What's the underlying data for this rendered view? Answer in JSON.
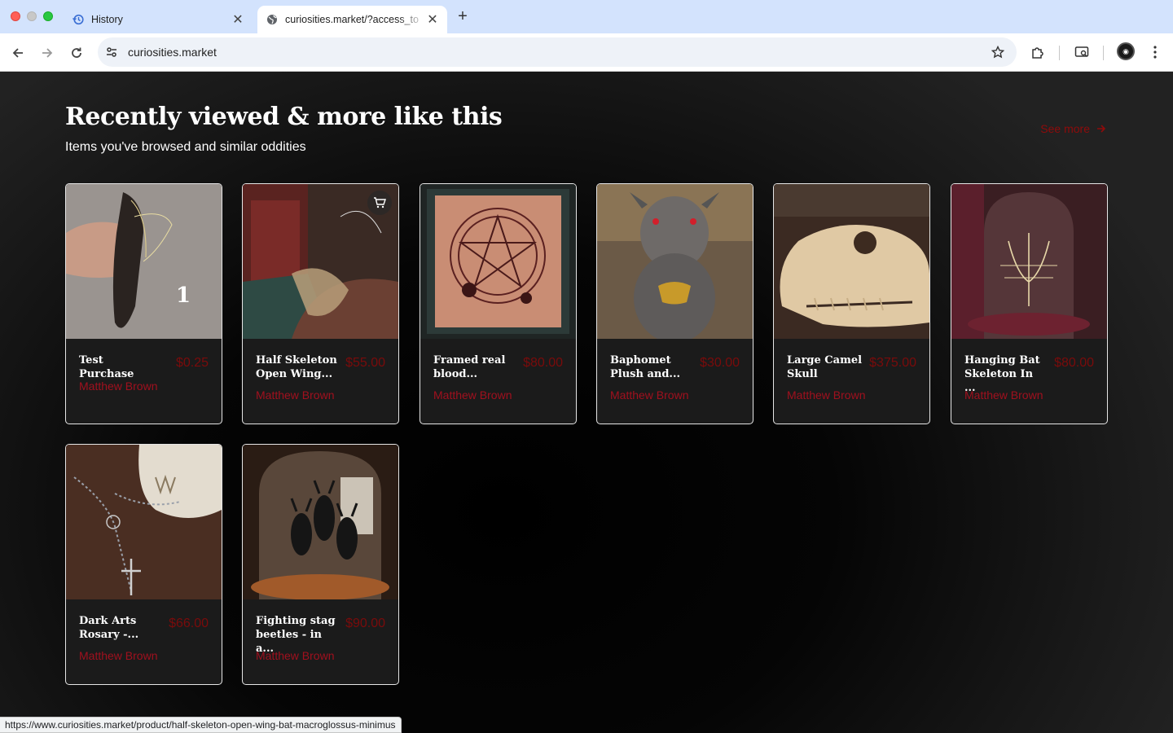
{
  "browser": {
    "tabs": [
      {
        "title": "History",
        "active": false,
        "icon": "history-icon"
      },
      {
        "title": "curiosities.market/?access_to",
        "active": true,
        "icon": "globe-icon"
      }
    ],
    "url": "curiosities.market",
    "status_url": "https://www.curiosities.market/product/half-skeleton-open-wing-bat-macroglossus-minimus"
  },
  "section": {
    "title": "Recently viewed & more like this",
    "subtitle": "Items you've browsed and similar oddities",
    "see_more": "See more"
  },
  "products": [
    {
      "name": "Test Purchase",
      "price": "$0.25",
      "seller": "Matthew Brown"
    },
    {
      "name": "Half Skeleton Open Wing...",
      "price": "$55.00",
      "seller": "Matthew Brown"
    },
    {
      "name": "Framed real blood...",
      "price": "$80.00",
      "seller": "Matthew Brown"
    },
    {
      "name": "Baphomet Plush and...",
      "price": "$30.00",
      "seller": "Matthew Brown"
    },
    {
      "name": "Large Camel Skull",
      "price": "$375.00",
      "seller": "Matthew Brown"
    },
    {
      "name": "Hanging Bat Skeleton In ...",
      "price": "$80.00",
      "seller": "Matthew Brown"
    },
    {
      "name": "Dark Arts Rosary -...",
      "price": "$66.00",
      "seller": "Matthew Brown"
    },
    {
      "name": "Fighting stag beetles - in a...",
      "price": "$90.00",
      "seller": "Matthew Brown"
    }
  ],
  "photo_text": {
    "test_purchase_number": "1"
  },
  "colors": {
    "price": "#7a0b0b",
    "seller": "#a0101e",
    "see_more": "#8f0b0b"
  }
}
